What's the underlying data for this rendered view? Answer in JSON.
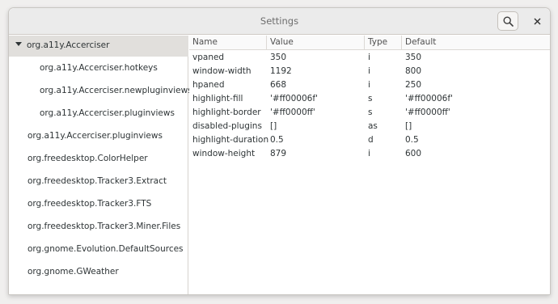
{
  "window": {
    "title": "Settings"
  },
  "icons": {
    "search": "search-icon",
    "close": "close-icon",
    "expander": "triangle-down-icon"
  },
  "sidebar": {
    "items": [
      {
        "label": "org.a11y.Accerciser",
        "level": 0,
        "expanded": true,
        "selected": true
      },
      {
        "label": "org.a11y.Accerciser.hotkeys",
        "level": 1
      },
      {
        "label": "org.a11y.Accerciser.newpluginviews",
        "level": 1
      },
      {
        "label": "org.a11y.Accerciser.pluginviews",
        "level": 1
      },
      {
        "label": "org.a11y.Accerciser.pluginviews",
        "level": 0
      },
      {
        "label": "org.freedesktop.ColorHelper",
        "level": 0
      },
      {
        "label": "org.freedesktop.Tracker3.Extract",
        "level": 0
      },
      {
        "label": "org.freedesktop.Tracker3.FTS",
        "level": 0
      },
      {
        "label": "org.freedesktop.Tracker3.Miner.Files",
        "level": 0
      },
      {
        "label": "org.gnome.Evolution.DefaultSources",
        "level": 0
      },
      {
        "label": "org.gnome.GWeather",
        "level": 0
      }
    ]
  },
  "table": {
    "columns": [
      "Name",
      "Value",
      "Type",
      "Default"
    ],
    "rows": [
      {
        "name": "vpaned",
        "value": "350",
        "type": "i",
        "default": "350"
      },
      {
        "name": "window-width",
        "value": "1192",
        "type": "i",
        "default": "800"
      },
      {
        "name": "hpaned",
        "value": "668",
        "type": "i",
        "default": "250"
      },
      {
        "name": "highlight-fill",
        "value": "'#ff00006f'",
        "type": "s",
        "default": "'#ff00006f'"
      },
      {
        "name": "highlight-border",
        "value": "'#ff0000ff'",
        "type": "s",
        "default": "'#ff0000ff'"
      },
      {
        "name": "disabled-plugins",
        "value": "[]",
        "type": "as",
        "default": "[]"
      },
      {
        "name": "highlight-duration",
        "value": "0.5",
        "type": "d",
        "default": "0.5"
      },
      {
        "name": "window-height",
        "value": "879",
        "type": "i",
        "default": "600"
      }
    ]
  }
}
